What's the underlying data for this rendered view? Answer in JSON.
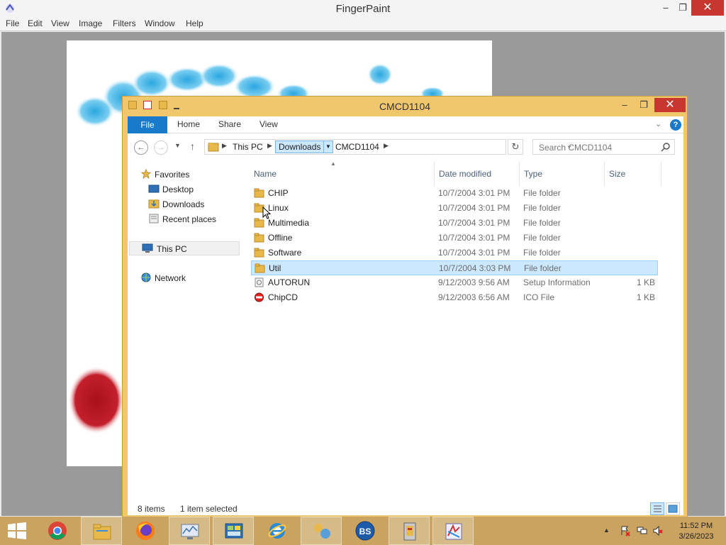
{
  "fingerpaint": {
    "title": "FingerPaint",
    "menu": [
      "File",
      "Edit",
      "View",
      "Image",
      "Filters",
      "Window",
      "Help"
    ],
    "controls": {
      "minimize": "–",
      "maximize": "❐",
      "close": "✕"
    }
  },
  "explorer": {
    "title": "CMCD1104",
    "ribbon": {
      "file": "File",
      "tabs": [
        "Home",
        "Share",
        "View"
      ],
      "help": "?"
    },
    "address": {
      "crumbs": [
        "This PC",
        "Downloads",
        "CMCD1104"
      ]
    },
    "search": {
      "placeholder": "Search CMCD1104"
    },
    "nav": {
      "favorites": "Favorites",
      "desktop": "Desktop",
      "downloads": "Downloads",
      "recent": "Recent places",
      "this_pc": "This PC",
      "network": "Network"
    },
    "columns": {
      "name": "Name",
      "date": "Date modified",
      "type": "Type",
      "size": "Size"
    },
    "files": [
      {
        "name": "CHIP",
        "date": "10/7/2004 3:01 PM",
        "type": "File folder",
        "size": "",
        "icon": "folder-icon"
      },
      {
        "name": "Linux",
        "date": "10/7/2004 3:01 PM",
        "type": "File folder",
        "size": "",
        "icon": "folder-icon"
      },
      {
        "name": "Multimedia",
        "date": "10/7/2004 3:01 PM",
        "type": "File folder",
        "size": "",
        "icon": "folder-icon"
      },
      {
        "name": "Offline",
        "date": "10/7/2004 3:01 PM",
        "type": "File folder",
        "size": "",
        "icon": "folder-icon"
      },
      {
        "name": "Software",
        "date": "10/7/2004 3:01 PM",
        "type": "File folder",
        "size": "",
        "icon": "folder-icon"
      },
      {
        "name": "Util",
        "date": "10/7/2004 3:03 PM",
        "type": "File folder",
        "size": "",
        "icon": "folder-icon",
        "selected": true
      },
      {
        "name": "AUTORUN",
        "date": "9/12/2003 9:56 AM",
        "type": "Setup Information",
        "size": "1 KB",
        "icon": "setup-file-icon"
      },
      {
        "name": "ChipCD",
        "date": "9/12/2003 6:56 AM",
        "type": "ICO File",
        "size": "1 KB",
        "icon": "ico-file-icon"
      }
    ],
    "status": {
      "count": "8 items",
      "selection": "1 item selected"
    }
  },
  "taskbar": {
    "clock_time": "11:52 PM",
    "clock_date": "3/26/2023"
  },
  "colors": {
    "explorer_frame": "#f1c76e",
    "taskbar": "#c9a35f",
    "accent": "#1979ca",
    "selection": "#cce8ff",
    "close": "#c7372f"
  }
}
